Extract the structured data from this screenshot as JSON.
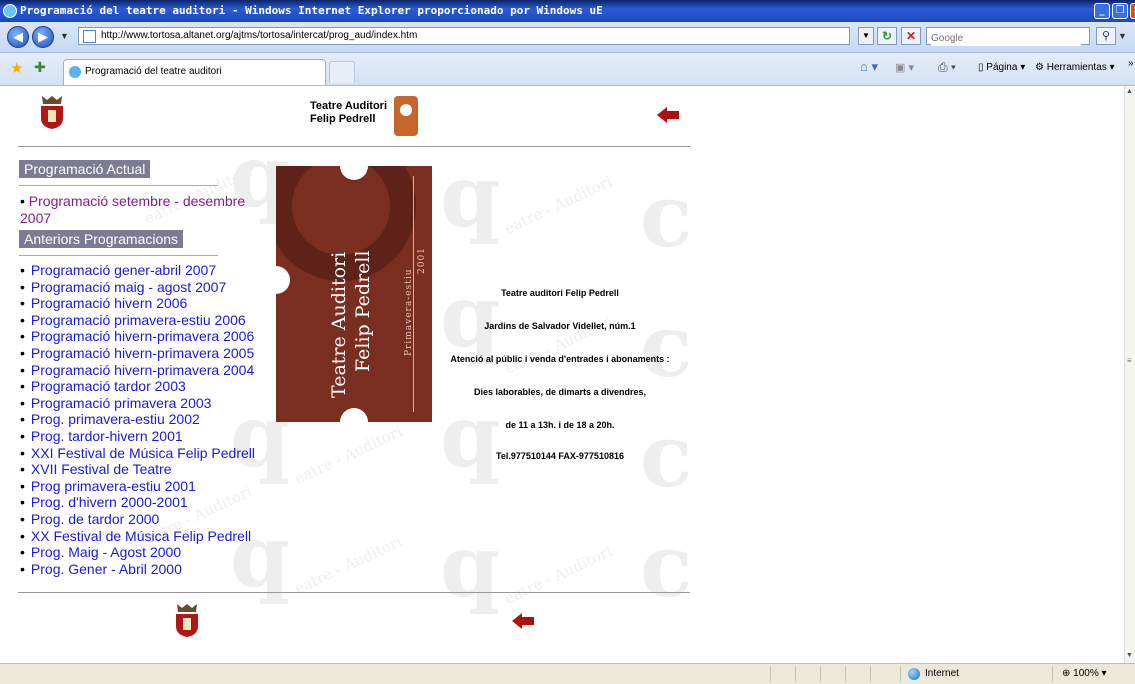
{
  "window": {
    "title": "Programació del teatre auditori - Windows Internet Explorer proporcionado por Windows uE"
  },
  "address_bar": {
    "url": "http://www.tortosa.altanet.org/ajtms/tortosa/intercat/prog_aud/index.htm",
    "search_placeholder": "Google"
  },
  "tabs": [
    {
      "label": "Programació del teatre auditori"
    }
  ],
  "command_bar": {
    "page_label": "Página",
    "tools_label": "Herramientas"
  },
  "page": {
    "logo": {
      "line1": "Teatre Auditori",
      "line2": "Felip Pedrell"
    },
    "current_heading": "Programació Actual",
    "current_item": "Programació setembre - desembre 2007",
    "previous_heading": "Anteriors Programacions",
    "previous_items": [
      "Programació gener-abril 2007",
      "Programació maig - agost 2007",
      "Programació hivern 2006",
      "Programació primavera-estiu 2006",
      "Programació hivern-primavera 2006",
      "Programació hivern-primavera 2005",
      "Programació hivern-primavera 2004",
      "Programació tardor 2003",
      "Programació primavera 2003",
      "Prog. primavera-estiu 2002",
      "Prog. tardor-hivern 2001",
      "XXI Festival de Música Felip Pedrell",
      "XVII Festival de Teatre",
      "Prog primavera-estiu 2001",
      "Prog. d'hivern 2000-2001",
      "Prog. de tardor 2000",
      "XX Festival de Música Felip Pedrell",
      "Prog. Maig - Agost 2000",
      "Prog. Gener - Abril 2000"
    ],
    "brochure": {
      "title_line1": "Teatre Auditori",
      "title_line2": "Felip Pedrell",
      "season": "Primavera-estiu",
      "year": "2001"
    },
    "info": [
      "Teatre auditori Felip Pedrell",
      "Jardins de Salvador Videllet, núm.1",
      "Atenció al públic i venda d'entrades i abonaments :",
      "Dies laborables, de dimarts a divendres,",
      "de 11 a 13h. i de 18 a 20h.",
      "Tel.977510144 FAX-977510816"
    ],
    "watermark_text": "eatre - Auditori"
  },
  "status_bar": {
    "zone": "Internet",
    "zoom": "100%"
  },
  "colors": {
    "heading_bg": "#7b7b94",
    "link": "#1a1add",
    "visited_link": "#8b1a8b",
    "arrow_red": "#b01010",
    "brochure": "#7a2e20"
  }
}
